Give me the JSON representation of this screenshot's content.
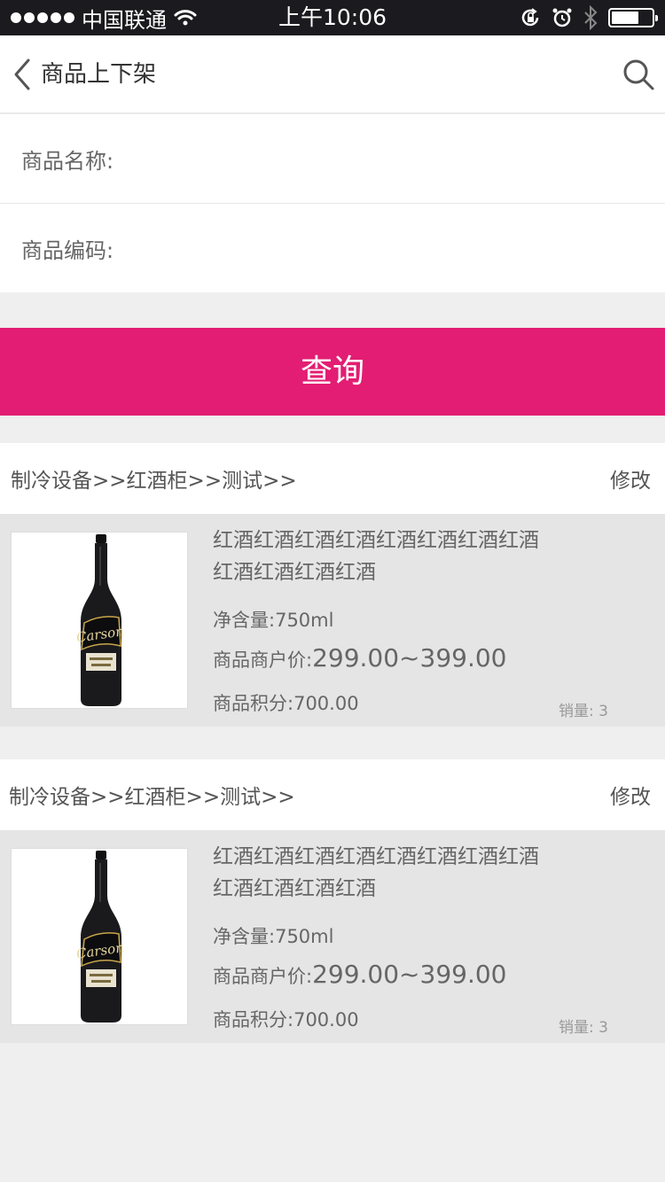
{
  "status_bar": {
    "carrier": "中国联通",
    "time": "上午10:06",
    "icons": [
      "signal-dots-icon",
      "wifi-icon",
      "rotation-lock-icon",
      "alarm-icon",
      "bluetooth-icon",
      "battery-icon"
    ]
  },
  "nav": {
    "back_icon": "chevron-left-icon",
    "title": "商品上下架",
    "search_icon": "search-icon"
  },
  "form": {
    "name_label": "商品名称:",
    "name_value": "",
    "code_label": "商品编码:",
    "code_value": ""
  },
  "query_button": "查询",
  "colors": {
    "accent": "#e31d73",
    "status_bar": "#1b1b1f",
    "background": "#efefef",
    "card_body": "#e5e5e5"
  },
  "products": [
    {
      "category_path": "制冷设备>>红酒柜>>测试>>",
      "edit_label": "修改",
      "name": "红酒红酒红酒红酒红酒红酒红酒红酒红酒红酒红酒红酒",
      "net_label": "净含量:",
      "net_value": "750ml",
      "price_label": "商品商户价:",
      "price_value": "299.00~399.00",
      "points_label": "商品积分:",
      "points_value": "700.00",
      "sales": "销量: 3",
      "bottle_label": "Carson"
    },
    {
      "category_path": "制冷设备>>红酒柜>>测试>>",
      "edit_label": "修改",
      "name": "红酒红酒红酒红酒红酒红酒红酒红酒红酒红酒红酒红酒",
      "net_label": "净含量:",
      "net_value": "750ml",
      "price_label": "商品商户价:",
      "price_value": "299.00~399.00",
      "points_label": "商品积分:",
      "points_value": "700.00",
      "sales": "销量: 3",
      "bottle_label": "Carson"
    }
  ]
}
